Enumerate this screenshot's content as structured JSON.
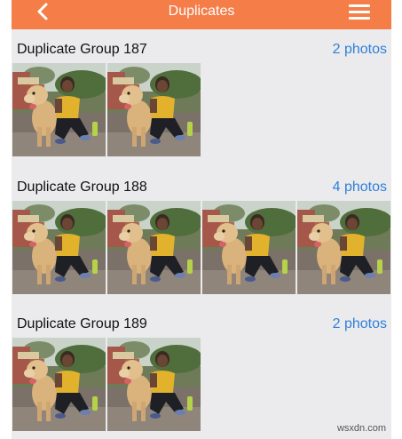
{
  "header": {
    "title": "Duplicates",
    "back_icon": "chevron-left-icon",
    "menu_icon": "hamburger-menu-icon",
    "color": "#f47d48"
  },
  "groups": [
    {
      "name": "Duplicate Group 187",
      "count_label": "2 photos",
      "photos": 2
    },
    {
      "name": "Duplicate Group 188",
      "count_label": "4 photos",
      "photos": 4
    },
    {
      "name": "Duplicate Group 189",
      "count_label": "2 photos",
      "photos": 2
    }
  ],
  "watermark": "wsxdn.com",
  "colors": {
    "link": "#2f7fd8",
    "background": "#ebebed"
  }
}
